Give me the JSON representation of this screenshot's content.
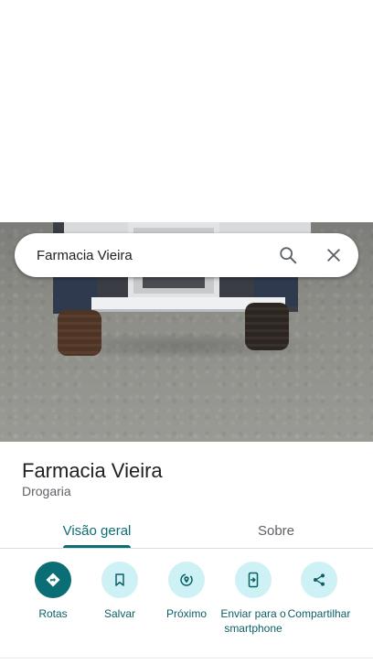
{
  "search": {
    "query": "Farmacia Vieira",
    "search_icon": "search-icon",
    "close_icon": "close-icon"
  },
  "place": {
    "name": "Farmacia Vieira",
    "category": "Drogaria"
  },
  "tabs": [
    {
      "label": "Visão geral",
      "active": true
    },
    {
      "label": "Sobre",
      "active": false
    }
  ],
  "actions": [
    {
      "label": "Rotas",
      "icon": "directions-icon"
    },
    {
      "label": "Salvar",
      "icon": "bookmark-icon"
    },
    {
      "label": "Próximo",
      "icon": "nearby-icon"
    },
    {
      "label": "Enviar para o smartphone",
      "icon": "send-to-phone-icon"
    },
    {
      "label": "Compartilhar",
      "icon": "share-icon"
    }
  ],
  "colors": {
    "accent": "#0b6e74",
    "accent_light": "#cdf1f5",
    "text": "#202124",
    "muted": "#5f6368"
  }
}
